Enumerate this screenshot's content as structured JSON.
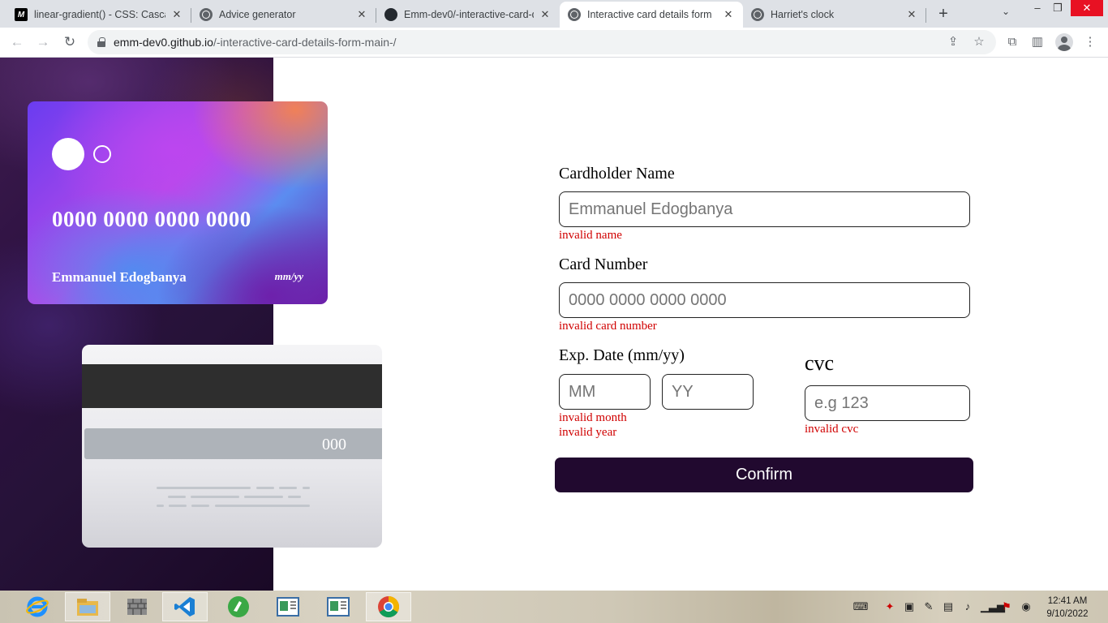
{
  "browser": {
    "tabs": [
      {
        "title": "linear-gradient() - CSS: Cascading",
        "icon": "mdn-icon"
      },
      {
        "title": "Advice generator",
        "icon": "globe-icon"
      },
      {
        "title": "Emm-dev0/-interactive-card-details",
        "icon": "github-icon"
      },
      {
        "title": "Interactive card details form",
        "icon": "globe-icon",
        "active": true
      },
      {
        "title": "Harriet's clock",
        "icon": "globe-icon"
      }
    ],
    "url_host": "emm-dev0.github.io",
    "url_path": "/-interactive-card-details-form-main-/"
  },
  "card_front": {
    "number": "0000 0000 0000 0000",
    "name": "Emmanuel Edogbanya",
    "expiry": "mm/yy"
  },
  "card_back": {
    "cvc": "000"
  },
  "form": {
    "cardholder_label": "Cardholder Name",
    "cardholder_value": "Emmanuel Edogbanya",
    "cardholder_error": "invalid name",
    "number_label": "Card Number",
    "number_placeholder": "0000 0000 0000 0000",
    "number_error": "invalid card number",
    "exp_label": "Exp. Date (mm/yy)",
    "month_placeholder": "MM",
    "year_placeholder": "YY",
    "month_error": "invalid month",
    "year_error": "invalid year",
    "cvc_label": "cvc",
    "cvc_placeholder": "e.g 123",
    "cvc_error": "invalid cvc",
    "confirm_label": "Confirm"
  },
  "taskbar": {
    "time": "12:41 AM",
    "date": "9/10/2022"
  },
  "colors": {
    "accent": "#21092f",
    "error": "#d00000"
  }
}
